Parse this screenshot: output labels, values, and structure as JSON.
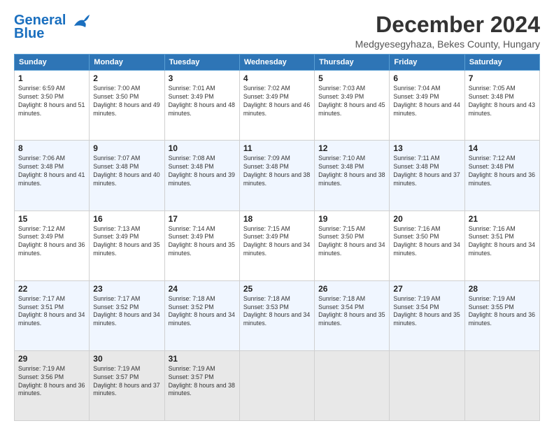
{
  "logo": {
    "line1": "General",
    "line2": "Blue"
  },
  "title": "December 2024",
  "subtitle": "Medgyesegyhaza, Bekes County, Hungary",
  "days_of_week": [
    "Sunday",
    "Monday",
    "Tuesday",
    "Wednesday",
    "Thursday",
    "Friday",
    "Saturday"
  ],
  "weeks": [
    [
      {
        "day": 1,
        "sunrise": "6:59 AM",
        "sunset": "3:50 PM",
        "daylight": "8 hours and 51 minutes."
      },
      {
        "day": 2,
        "sunrise": "7:00 AM",
        "sunset": "3:50 PM",
        "daylight": "8 hours and 49 minutes."
      },
      {
        "day": 3,
        "sunrise": "7:01 AM",
        "sunset": "3:49 PM",
        "daylight": "8 hours and 48 minutes."
      },
      {
        "day": 4,
        "sunrise": "7:02 AM",
        "sunset": "3:49 PM",
        "daylight": "8 hours and 46 minutes."
      },
      {
        "day": 5,
        "sunrise": "7:03 AM",
        "sunset": "3:49 PM",
        "daylight": "8 hours and 45 minutes."
      },
      {
        "day": 6,
        "sunrise": "7:04 AM",
        "sunset": "3:49 PM",
        "daylight": "8 hours and 44 minutes."
      },
      {
        "day": 7,
        "sunrise": "7:05 AM",
        "sunset": "3:48 PM",
        "daylight": "8 hours and 43 minutes."
      }
    ],
    [
      {
        "day": 8,
        "sunrise": "7:06 AM",
        "sunset": "3:48 PM",
        "daylight": "8 hours and 41 minutes."
      },
      {
        "day": 9,
        "sunrise": "7:07 AM",
        "sunset": "3:48 PM",
        "daylight": "8 hours and 40 minutes."
      },
      {
        "day": 10,
        "sunrise": "7:08 AM",
        "sunset": "3:48 PM",
        "daylight": "8 hours and 39 minutes."
      },
      {
        "day": 11,
        "sunrise": "7:09 AM",
        "sunset": "3:48 PM",
        "daylight": "8 hours and 38 minutes."
      },
      {
        "day": 12,
        "sunrise": "7:10 AM",
        "sunset": "3:48 PM",
        "daylight": "8 hours and 38 minutes."
      },
      {
        "day": 13,
        "sunrise": "7:11 AM",
        "sunset": "3:48 PM",
        "daylight": "8 hours and 37 minutes."
      },
      {
        "day": 14,
        "sunrise": "7:12 AM",
        "sunset": "3:48 PM",
        "daylight": "8 hours and 36 minutes."
      }
    ],
    [
      {
        "day": 15,
        "sunrise": "7:12 AM",
        "sunset": "3:49 PM",
        "daylight": "8 hours and 36 minutes."
      },
      {
        "day": 16,
        "sunrise": "7:13 AM",
        "sunset": "3:49 PM",
        "daylight": "8 hours and 35 minutes."
      },
      {
        "day": 17,
        "sunrise": "7:14 AM",
        "sunset": "3:49 PM",
        "daylight": "8 hours and 35 minutes."
      },
      {
        "day": 18,
        "sunrise": "7:15 AM",
        "sunset": "3:49 PM",
        "daylight": "8 hours and 34 minutes."
      },
      {
        "day": 19,
        "sunrise": "7:15 AM",
        "sunset": "3:50 PM",
        "daylight": "8 hours and 34 minutes."
      },
      {
        "day": 20,
        "sunrise": "7:16 AM",
        "sunset": "3:50 PM",
        "daylight": "8 hours and 34 minutes."
      },
      {
        "day": 21,
        "sunrise": "7:16 AM",
        "sunset": "3:51 PM",
        "daylight": "8 hours and 34 minutes."
      }
    ],
    [
      {
        "day": 22,
        "sunrise": "7:17 AM",
        "sunset": "3:51 PM",
        "daylight": "8 hours and 34 minutes."
      },
      {
        "day": 23,
        "sunrise": "7:17 AM",
        "sunset": "3:52 PM",
        "daylight": "8 hours and 34 minutes."
      },
      {
        "day": 24,
        "sunrise": "7:18 AM",
        "sunset": "3:52 PM",
        "daylight": "8 hours and 34 minutes."
      },
      {
        "day": 25,
        "sunrise": "7:18 AM",
        "sunset": "3:53 PM",
        "daylight": "8 hours and 34 minutes."
      },
      {
        "day": 26,
        "sunrise": "7:18 AM",
        "sunset": "3:54 PM",
        "daylight": "8 hours and 35 minutes."
      },
      {
        "day": 27,
        "sunrise": "7:19 AM",
        "sunset": "3:54 PM",
        "daylight": "8 hours and 35 minutes."
      },
      {
        "day": 28,
        "sunrise": "7:19 AM",
        "sunset": "3:55 PM",
        "daylight": "8 hours and 36 minutes."
      }
    ],
    [
      {
        "day": 29,
        "sunrise": "7:19 AM",
        "sunset": "3:56 PM",
        "daylight": "8 hours and 36 minutes."
      },
      {
        "day": 30,
        "sunrise": "7:19 AM",
        "sunset": "3:57 PM",
        "daylight": "8 hours and 37 minutes."
      },
      {
        "day": 31,
        "sunrise": "7:19 AM",
        "sunset": "3:57 PM",
        "daylight": "8 hours and 38 minutes."
      },
      null,
      null,
      null,
      null
    ]
  ]
}
